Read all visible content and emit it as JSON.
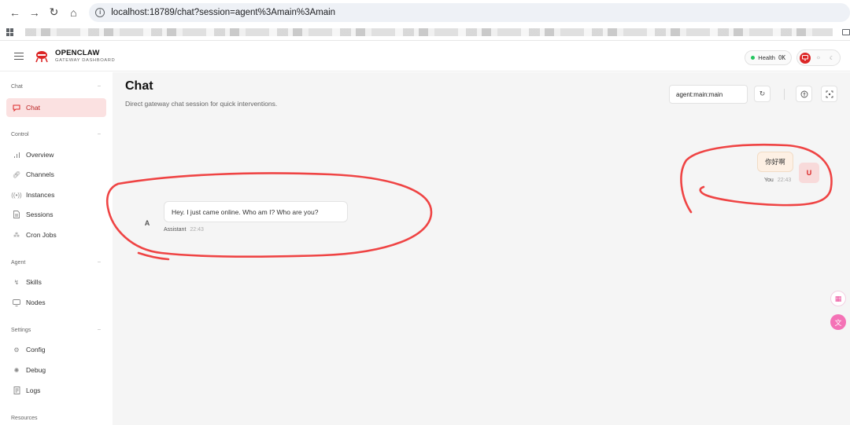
{
  "browser": {
    "url": "localhost:18789/chat?session=agent%3Amain%3Amain",
    "nav_icons": [
      "back-icon",
      "forward-icon",
      "reload-icon",
      "home-icon"
    ]
  },
  "header": {
    "brand_title": "OPENCLAW",
    "brand_subtitle": "GATEWAY DASHBOARD",
    "health_label": "Health",
    "health_status": "OK",
    "theme_icons": [
      "monitor-icon",
      "sun-icon",
      "moon-icon"
    ],
    "accent_color": "#dc2626"
  },
  "sidebar": {
    "sections": [
      {
        "label": "Chat",
        "items": [
          {
            "label": "Chat",
            "icon": "message-icon",
            "active": true
          }
        ]
      },
      {
        "label": "Control",
        "items": [
          {
            "label": "Overview",
            "icon": "bar-chart-icon"
          },
          {
            "label": "Channels",
            "icon": "link-icon"
          },
          {
            "label": "Instances",
            "icon": "radio-icon"
          },
          {
            "label": "Sessions",
            "icon": "file-icon"
          },
          {
            "label": "Cron Jobs",
            "icon": "loader-icon"
          }
        ]
      },
      {
        "label": "Agent",
        "items": [
          {
            "label": "Skills",
            "icon": "zap-icon"
          },
          {
            "label": "Nodes",
            "icon": "monitor-icon"
          }
        ]
      },
      {
        "label": "Settings",
        "items": [
          {
            "label": "Config",
            "icon": "gear-icon"
          },
          {
            "label": "Debug",
            "icon": "bug-icon"
          },
          {
            "label": "Logs",
            "icon": "scroll-icon"
          }
        ]
      },
      {
        "label": "Resources",
        "items": []
      }
    ]
  },
  "main": {
    "title": "Chat",
    "subtitle": "Direct gateway chat session for quick interventions.",
    "session_value": "agent:main:main",
    "toolbar_icons": [
      "refresh-icon",
      "brain-icon",
      "focus-icon"
    ]
  },
  "messages": [
    {
      "role": "user",
      "avatar": "U",
      "text": "你好啊",
      "sender": "You",
      "time": "22:43"
    },
    {
      "role": "assistant",
      "avatar": "A",
      "text": "Hey. I just came online. Who am I? Who are you?",
      "sender": "Assistant",
      "time": "22:43"
    }
  ],
  "annotation_color": "#ef4444"
}
